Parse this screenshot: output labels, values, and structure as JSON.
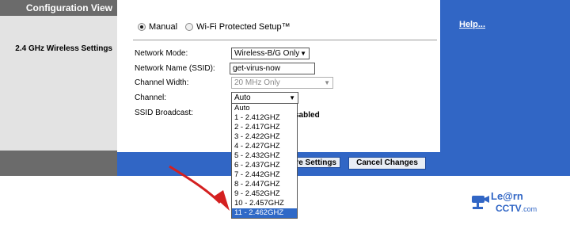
{
  "left": {
    "header": "Configuration View",
    "section_label": "2.4 GHz Wireless Settings"
  },
  "help": {
    "label": "Help..."
  },
  "setup_mode": {
    "manual": "Manual",
    "wps": "Wi-Fi Protected Setup™",
    "selected": "manual"
  },
  "form": {
    "network_mode": {
      "label": "Network Mode:",
      "value": "Wireless-B/G Only"
    },
    "ssid": {
      "label": "Network Name (SSID):",
      "value": "get-virus-now"
    },
    "channel_width": {
      "label": "Channel Width:",
      "value": "20 MHz Only"
    },
    "channel": {
      "label": "Channel:",
      "value": "Auto"
    },
    "ssid_broadcast": {
      "label": "SSID Broadcast:",
      "value_fragment": "sabled"
    }
  },
  "channel_options": [
    "Auto",
    "1 - 2.412GHZ",
    "2 - 2.417GHZ",
    "3 - 2.422GHZ",
    "4 - 2.427GHZ",
    "5 - 2.432GHZ",
    "6 - 2.437GHZ",
    "7 - 2.442GHZ",
    "8 - 2.447GHZ",
    "9 - 2.452GHZ",
    "10 - 2.457GHZ",
    "11 - 2.462GHZ"
  ],
  "channel_highlighted_index": 11,
  "buttons": {
    "save_fragment": "re Settings",
    "cancel": "Cancel Changes"
  },
  "logo": {
    "line1": "Le@rn",
    "line2": "CCTV",
    "suffix": ".com",
    "icon": "cctv-camera-icon"
  },
  "colors": {
    "header_gray": "#6b6b6b",
    "panel_gray": "#e3e3e3",
    "brand_blue": "#3166c5",
    "highlight_blue": "#2f69c7",
    "arrow_red": "#d42020"
  }
}
